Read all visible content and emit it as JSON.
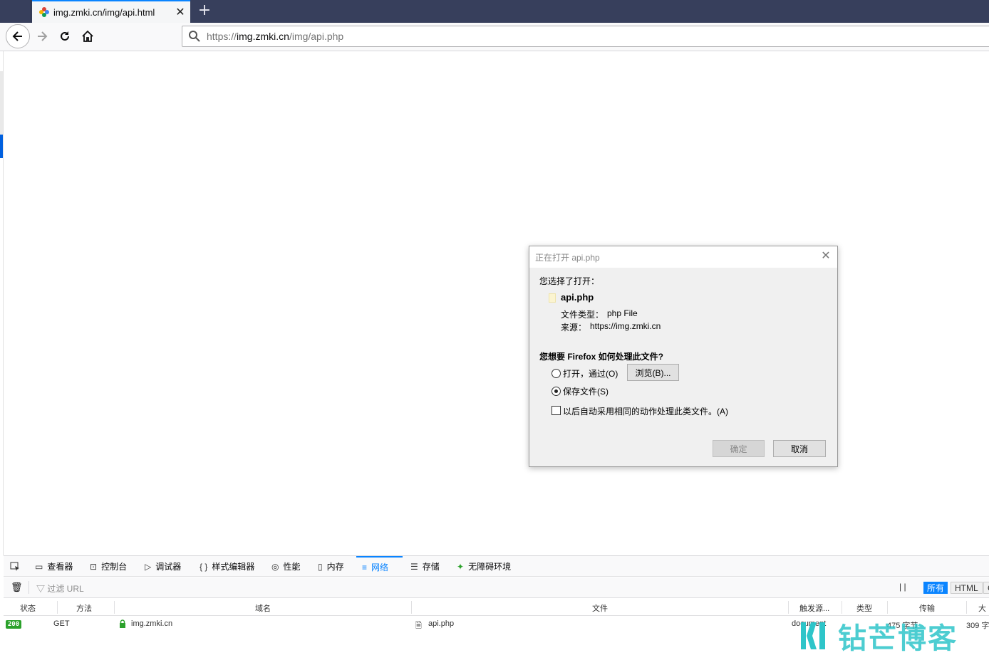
{
  "browser": {
    "tab": {
      "title": "img.zmki.cn/img/api.html",
      "close_glyph": "✕"
    },
    "new_tab_glyph": "+",
    "url": {
      "prefix": "https://",
      "host": "img.zmki.cn",
      "path": "/img/api.php"
    }
  },
  "dialog": {
    "title": "正在打开 api.php",
    "close_glyph": "✕",
    "intro": "您选择了打开：",
    "filename": "api.php",
    "type_label": "文件类型：",
    "type_value": "php File",
    "source_label": "来源：",
    "source_value": "https://img.zmki.cn",
    "question": "您想要 Firefox 如何处理此文件?",
    "option_open": "打开，通过(O)",
    "browse_button": "浏览(B)...",
    "option_save": "保存文件(S)",
    "option_save_selected": true,
    "auto_checkbox": "以后自动采用相同的动作处理此类文件。(A)",
    "auto_checked": false,
    "ok_button": "确定",
    "cancel_button": "取消"
  },
  "devtools": {
    "tabs": [
      {
        "label": "查看器",
        "icon": "inspector-icon"
      },
      {
        "label": "控制台",
        "icon": "console-icon"
      },
      {
        "label": "调试器",
        "icon": "debugger-icon"
      },
      {
        "label": "样式编辑器",
        "icon": "style-editor-icon"
      },
      {
        "label": "性能",
        "icon": "performance-icon"
      },
      {
        "label": "内存",
        "icon": "memory-icon"
      },
      {
        "label": "网络",
        "icon": "network-icon",
        "selected": true
      },
      {
        "label": "存储",
        "icon": "storage-icon"
      },
      {
        "label": "无障碍环境",
        "icon": "accessibility-icon"
      }
    ],
    "filter_placeholder": "过滤 URL",
    "filter_buttons": {
      "all": "所有",
      "html": "HTML",
      "c": "C"
    },
    "columns": [
      "状态",
      "方法",
      "域名",
      "文件",
      "触发源...",
      "类型",
      "传输",
      "大"
    ],
    "rows": [
      {
        "status": "200",
        "method": "GET",
        "domain": "img.zmki.cn",
        "file": "api.php",
        "cause": "document",
        "type": "475 字节",
        "transferred": "309 字"
      }
    ]
  },
  "watermark": {
    "text": "钻芒博客"
  },
  "colors": {
    "accent": "#0a84ff",
    "tabstrip": "#373f5c",
    "status_ok": "#2ba12b",
    "watermark": "#2ec5c9"
  }
}
